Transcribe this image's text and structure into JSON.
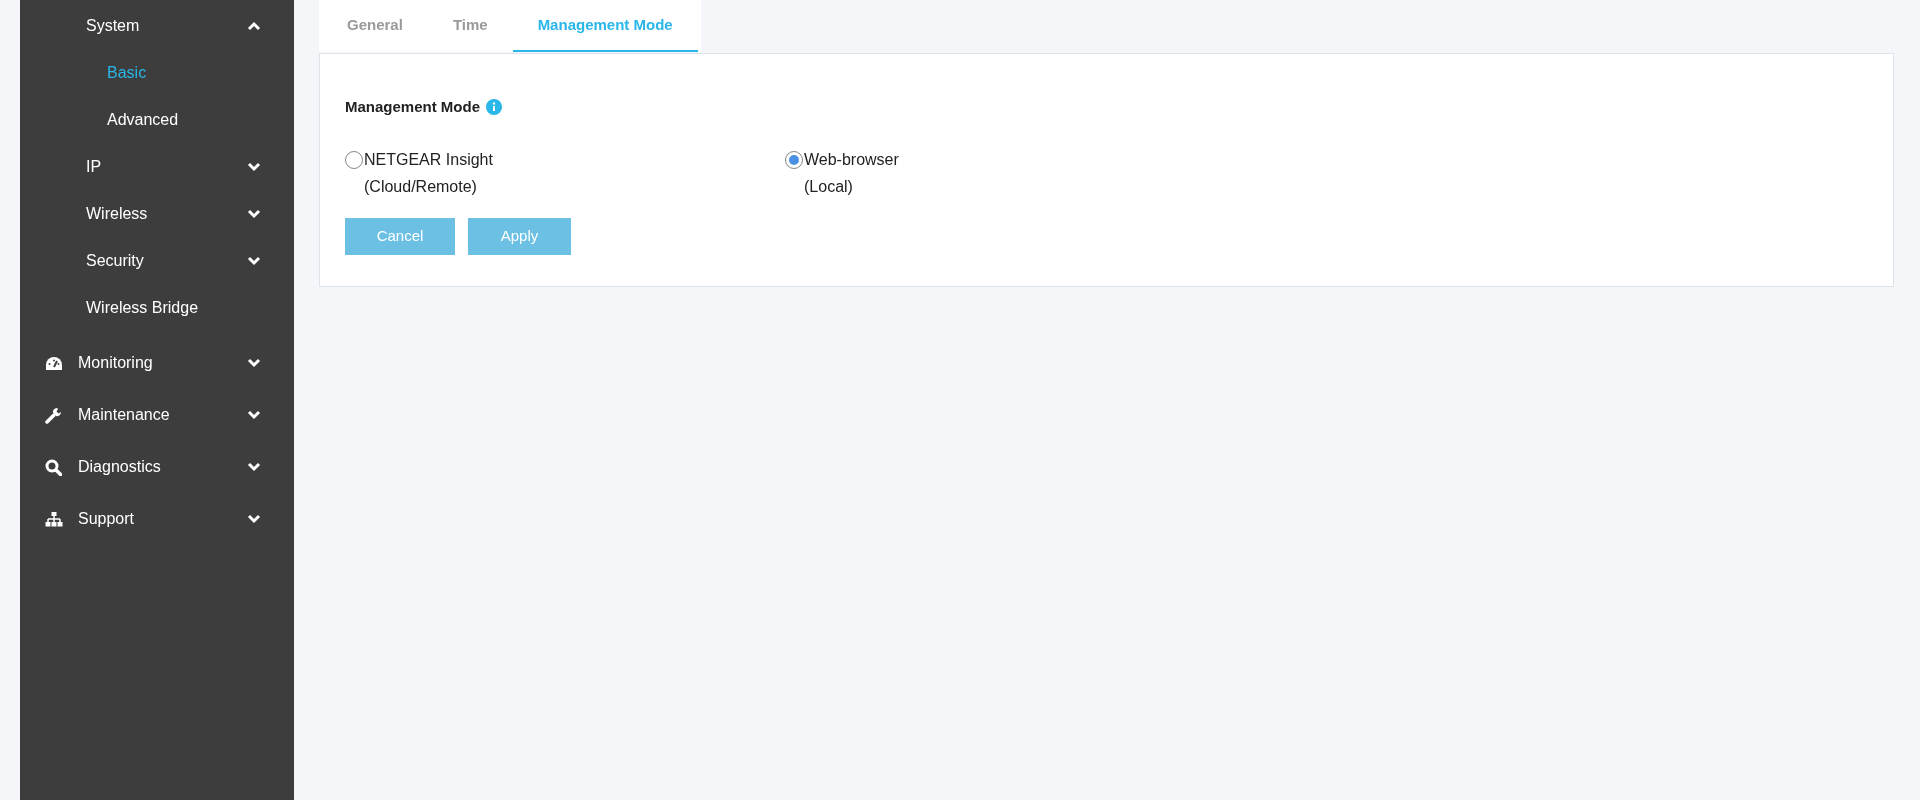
{
  "sidebar": {
    "continued_items": [
      {
        "label": "System",
        "kind": "group",
        "expanded": true,
        "selected": false,
        "children": [
          {
            "label": "Basic",
            "selected": true
          },
          {
            "label": "Advanced",
            "selected": false
          }
        ]
      },
      {
        "label": "IP",
        "kind": "group",
        "expanded": false,
        "selected": false
      },
      {
        "label": "Wireless",
        "kind": "group",
        "expanded": false,
        "selected": false
      },
      {
        "label": "Security",
        "kind": "group",
        "expanded": false,
        "selected": false
      },
      {
        "label": "Wireless Bridge",
        "kind": "link",
        "selected": false
      }
    ],
    "items": [
      {
        "label": "Monitoring",
        "kind": "group",
        "expanded": false,
        "selected": false
      },
      {
        "label": "Maintenance",
        "kind": "group",
        "expanded": false,
        "selected": false
      },
      {
        "label": "Diagnostics",
        "kind": "group",
        "expanded": false,
        "selected": false
      },
      {
        "label": "Support",
        "kind": "group",
        "expanded": false,
        "selected": false
      }
    ]
  },
  "tabs": [
    {
      "label": "General",
      "selected": false
    },
    {
      "label": "Time",
      "selected": false
    },
    {
      "label": "Management Mode",
      "selected": true
    }
  ],
  "panel": {
    "heading": "Management Mode",
    "options": [
      {
        "label": "NETGEAR Insight",
        "sublabel": "(Cloud/Remote)",
        "selected": false
      },
      {
        "label": "Web-browser",
        "sublabel": "(Local)",
        "selected": true
      }
    ],
    "buttons": [
      "Cancel",
      "Apply"
    ]
  }
}
